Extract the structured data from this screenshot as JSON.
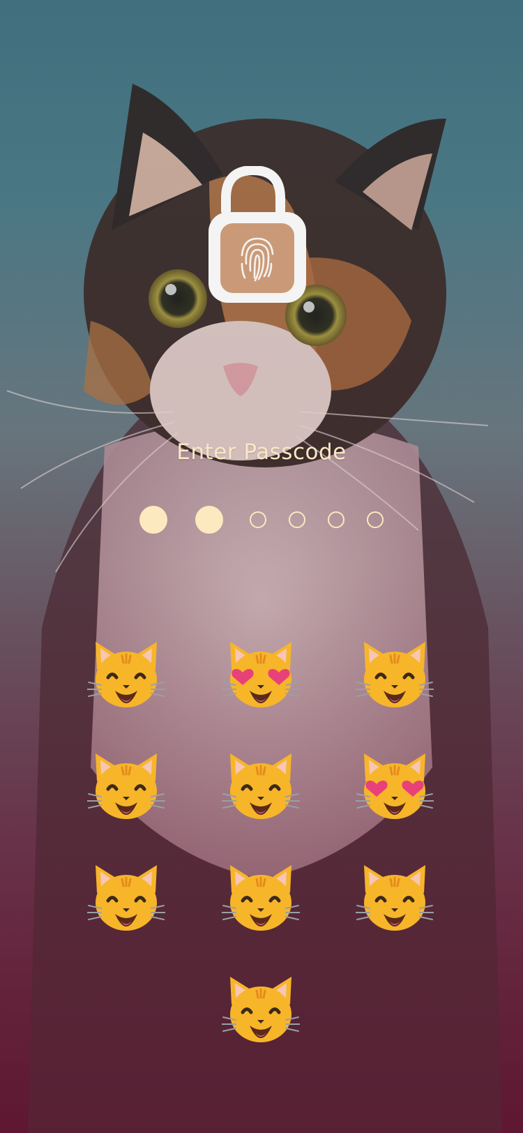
{
  "title": "Enter Passcode",
  "lock": {
    "icon": "fingerprint-lock-icon"
  },
  "passcode": {
    "length": 6,
    "filled": 2
  },
  "colors": {
    "accent": "#fde9bf",
    "cat_face": "#f7b52a",
    "heart": "#e8417a"
  },
  "keypad": {
    "keys": [
      {
        "icon": "grinning-cat-icon"
      },
      {
        "icon": "heart-eyes-cat-icon"
      },
      {
        "icon": "grinning-cat-icon"
      },
      {
        "icon": "grinning-cat-icon"
      },
      {
        "icon": "grinning-cat-icon"
      },
      {
        "icon": "heart-eyes-cat-icon"
      },
      {
        "icon": "grinning-cat-icon"
      },
      {
        "icon": "grinning-cat-icon"
      },
      {
        "icon": "grinning-cat-icon"
      },
      {
        "icon": "grinning-cat-icon"
      }
    ]
  }
}
